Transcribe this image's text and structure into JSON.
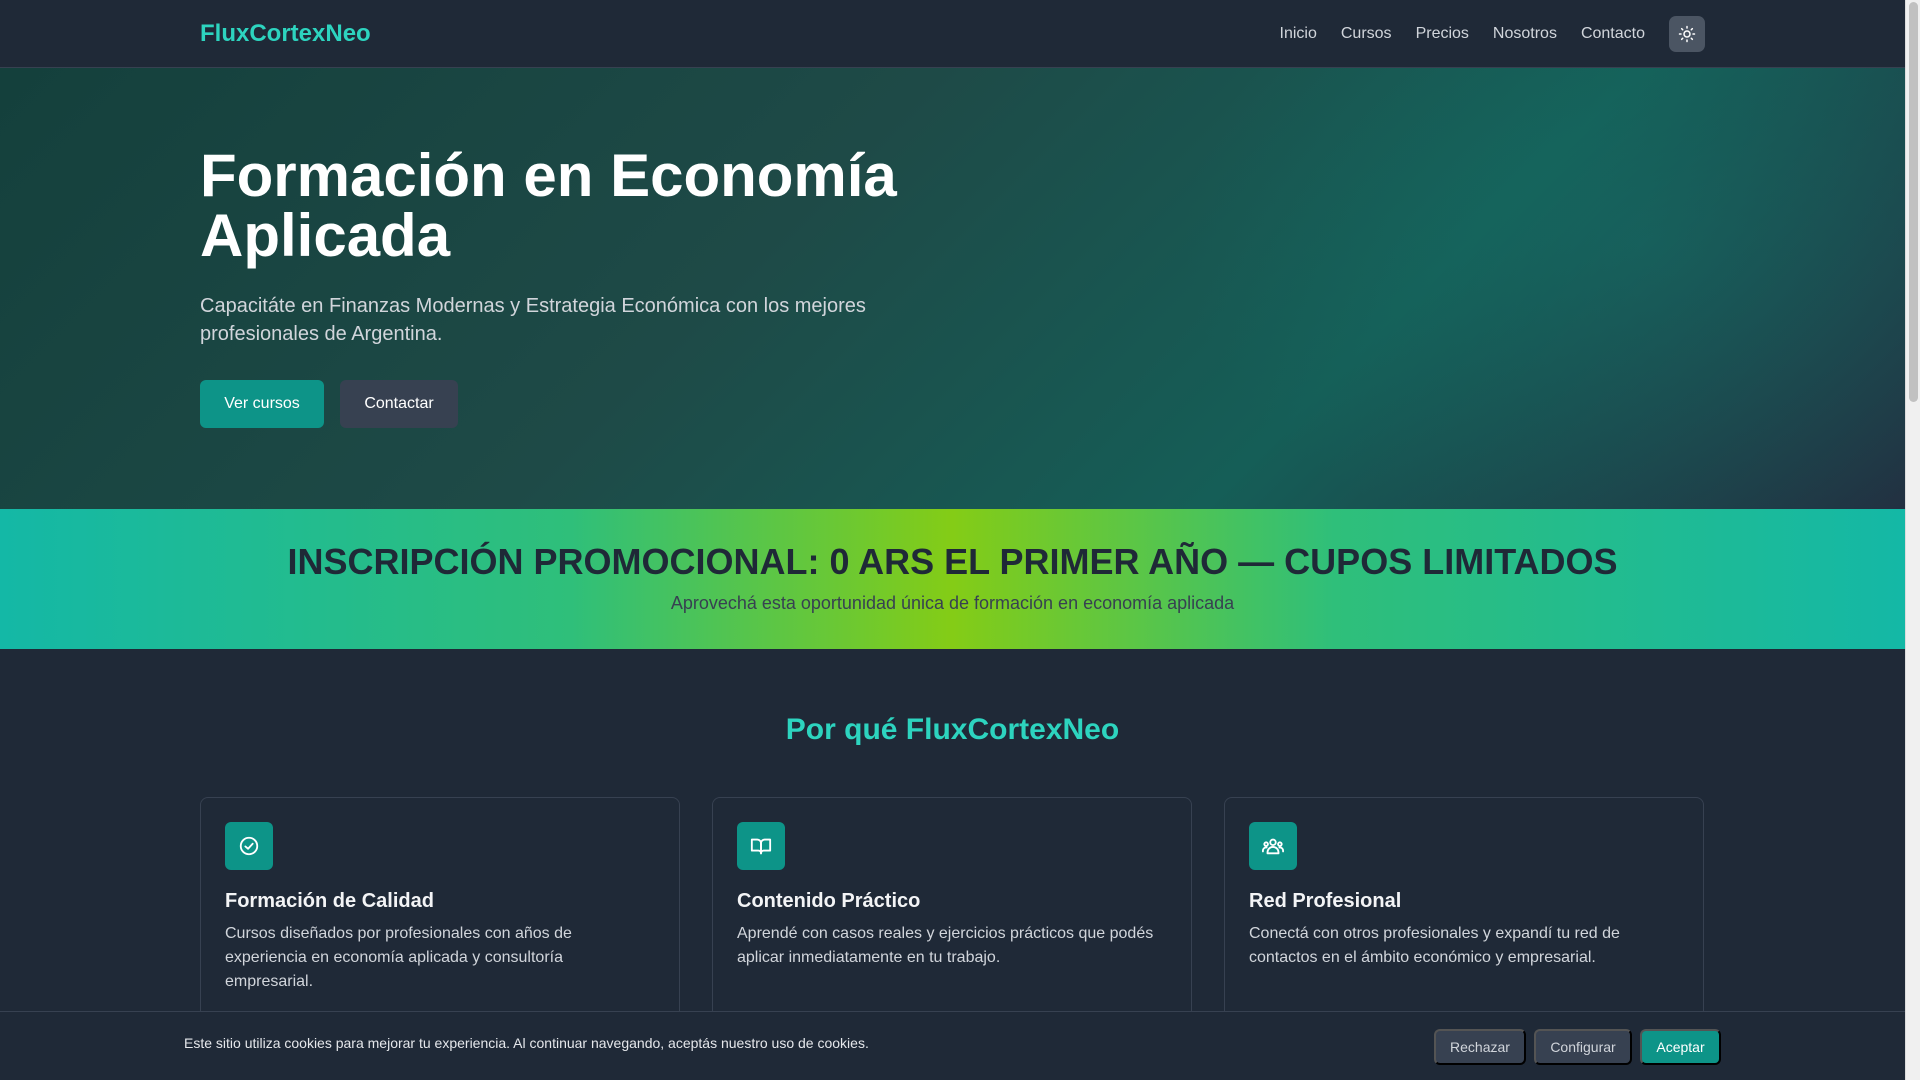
{
  "header": {
    "brand": "FluxCortexNeo",
    "nav": [
      "Inicio",
      "Cursos",
      "Precios",
      "Nosotros",
      "Contacto"
    ],
    "theme_icon": "sun-icon"
  },
  "hero": {
    "title": "Formación en Economía Aplicada",
    "subtitle": "Capacitáte en Finanzas Modernas y Estrategia Económica con los mejores profesionales de Argentina.",
    "primary_button": "Ver cursos",
    "secondary_button": "Contactar"
  },
  "promo": {
    "title": "INSCRIPCIÓN PROMOCIONAL: 0 ARS EL PRIMER AÑO — CUPOS LIMITADOS",
    "subtitle": "Aprovechá esta oportunidad única de formación en economía aplicada"
  },
  "features": {
    "title": "Por qué FluxCortexNeo",
    "cards": [
      {
        "icon": "check-circle-icon",
        "title": "Formación de Calidad",
        "text": "Cursos diseñados por profesionales con años de experiencia en economía aplicada y consultoría empresarial."
      },
      {
        "icon": "book-open-icon",
        "title": "Contenido Práctico",
        "text": "Aprendé con casos reales y ejercicios prácticos que podés aplicar inmediatamente en tu trabajo."
      },
      {
        "icon": "users-icon",
        "title": "Red Profesional",
        "text": "Conectá con otros profesionales y expandí tu red de contactos en el ámbito económico y empresarial."
      }
    ]
  },
  "cookie": {
    "text": "Este sitio utiliza cookies para mejorar tu experiencia. Al continuar navegando, aceptás nuestro uso de cookies.",
    "reject": "Rechazar",
    "configure": "Configurar",
    "accept": "Aceptar"
  },
  "colors": {
    "accent": "#2dd4bf",
    "button": "#0d9488",
    "background": "#1f2937"
  }
}
